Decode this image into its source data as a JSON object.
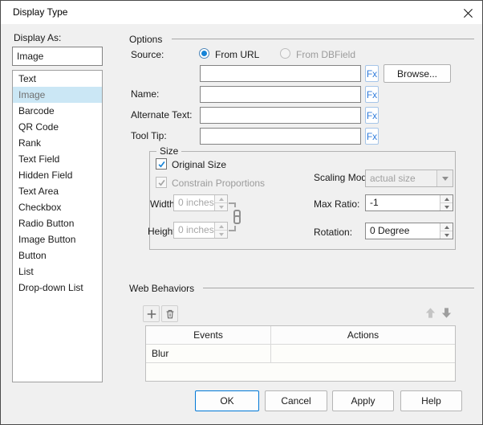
{
  "window": {
    "title": "Display Type"
  },
  "sidebar": {
    "label": "Display As:",
    "value": "Image",
    "selected_index": 1,
    "items": [
      "Text",
      "Image",
      "Barcode",
      "QR Code",
      "Rank",
      "Text Field",
      "Hidden Field",
      "Text Area",
      "Checkbox",
      "Radio Button",
      "Image Button",
      "Button",
      "List",
      "Drop-down List"
    ]
  },
  "options": {
    "group_label": "Options",
    "source_label": "Source:",
    "radio_from_url": "From URL",
    "radio_from_dbfield": "From DBField",
    "url_value": "",
    "fx_label": "Fx",
    "browse_label": "Browse...",
    "name_label": "Name:",
    "name_value": "",
    "alternate_text_label": "Alternate Text:",
    "alternate_text_value": "",
    "tool_tip_label": "Tool Tip:",
    "tool_tip_value": ""
  },
  "size": {
    "group_label": "Size",
    "original_size_label": "Original Size",
    "original_size_checked": true,
    "constrain_label": "Constrain Proportions",
    "constrain_checked": true,
    "width_label": "Width:",
    "width_value": "0 inches",
    "height_label": "Height:",
    "height_value": "0 inches",
    "scaling_label": "Scaling Mode:",
    "scaling_value": "actual size",
    "max_ratio_label": "Max Ratio:",
    "max_ratio_value": "-1",
    "rotation_label": "Rotation:",
    "rotation_value": "0 Degree"
  },
  "web_behaviors": {
    "group_label": "Web Behaviors",
    "columns": [
      "Events",
      "Actions"
    ],
    "rows": [
      {
        "event": "Blur",
        "action": ""
      }
    ]
  },
  "footer": {
    "ok": "OK",
    "cancel": "Cancel",
    "apply": "Apply",
    "help": "Help"
  },
  "colors": {
    "accent": "#0078d7",
    "selection_bg": "#cbe7f5",
    "fx_blue": "#2f7bdb",
    "titlebar_bg": "#ffffff",
    "dialog_bg": "#f0f0f0"
  }
}
